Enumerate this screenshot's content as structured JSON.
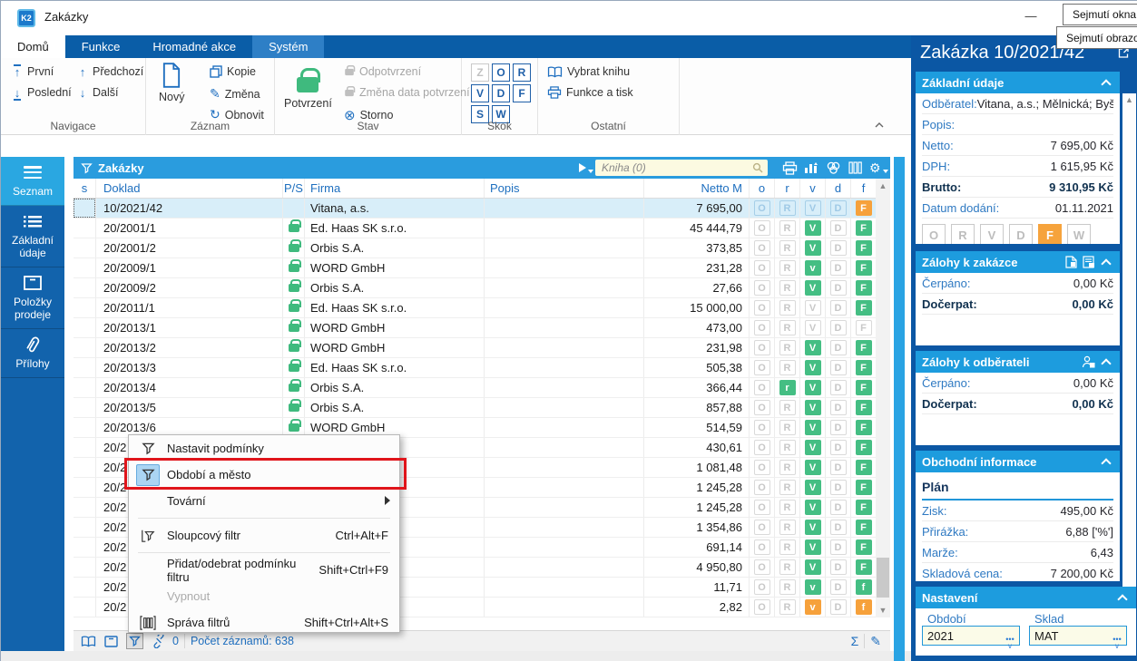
{
  "window": {
    "title": "Zakázky",
    "minimize_glyph": "—"
  },
  "capture_menu": {
    "items": [
      "Sejmutí okna",
      "Sejmutí obrazovk"
    ]
  },
  "ribbon": {
    "tabs": [
      {
        "label": "Domů"
      },
      {
        "label": "Funkce"
      },
      {
        "label": "Hromadné akce"
      },
      {
        "label": "Systém"
      }
    ],
    "groups": {
      "navigace": {
        "label": "Navigace",
        "items": [
          "První",
          "Poslední",
          "Předchozí",
          "Další"
        ]
      },
      "zaznam": {
        "label": "Záznam",
        "big": "Nový",
        "items": [
          "Kopie",
          "Změna",
          "Obnovit"
        ]
      },
      "stav": {
        "label": "Stav",
        "big": "Potvrzení",
        "items": [
          "Odpotvrzení",
          "Změna data potvrzení",
          "Storno"
        ]
      },
      "skok": {
        "label": "Skok",
        "letters": [
          "Z",
          "O",
          "R",
          "V",
          "D",
          "F",
          "S",
          "W"
        ]
      },
      "ostatni": {
        "label": "Ostatní",
        "items": [
          "Vybrat knihu",
          "Funkce a tisk"
        ]
      }
    }
  },
  "sidebar": {
    "items": [
      {
        "label": "Seznam"
      },
      {
        "label": "Základní údaje"
      },
      {
        "label": "Položky prodeje"
      },
      {
        "label": "Přílohy"
      }
    ]
  },
  "table": {
    "title": "Zakázky",
    "search_placeholder": "Kniha (0)",
    "columns": [
      "s",
      "Doklad",
      "P/S",
      "Firma",
      "Popis",
      "Netto M",
      "o",
      "r",
      "v",
      "d",
      "f"
    ],
    "rows": [
      {
        "sel": true,
        "doklad": "10/2021/42",
        "lock": "nolock",
        "firma": "Vitana, a.s.",
        "popis": "",
        "netto": "7 695,00",
        "bl": [
          "O",
          "R",
          "V",
          "D",
          "F"
        ],
        "bs": [
          "selb",
          "selb",
          "selb",
          "selb",
          "orange"
        ]
      },
      {
        "doklad": "20/2001/1",
        "lock": "lock",
        "firma": "Ed. Haas SK s.r.o.",
        "popis": "",
        "netto": "45 444,79",
        "bl": [
          "O",
          "R",
          "V",
          "D",
          "F"
        ],
        "bs": [
          "off",
          "off",
          "green",
          "off",
          "green"
        ]
      },
      {
        "doklad": "20/2001/2",
        "lock": "lock",
        "firma": "Orbis S.A.",
        "popis": "",
        "netto": "373,85",
        "bl": [
          "O",
          "R",
          "V",
          "D",
          "F"
        ],
        "bs": [
          "off",
          "off",
          "green",
          "off",
          "green"
        ]
      },
      {
        "doklad": "20/2009/1",
        "lock": "lock",
        "firma": "WORD GmbH",
        "popis": "",
        "netto": "231,28",
        "bl": [
          "O",
          "R",
          "v",
          "D",
          "F"
        ],
        "bs": [
          "off",
          "off",
          "green",
          "off",
          "green"
        ]
      },
      {
        "doklad": "20/2009/2",
        "lock": "lock",
        "firma": "Orbis S.A.",
        "popis": "",
        "netto": "27,66",
        "bl": [
          "O",
          "R",
          "V",
          "D",
          "F"
        ],
        "bs": [
          "off",
          "off",
          "green",
          "off",
          "green"
        ]
      },
      {
        "doklad": "20/2011/1",
        "lock": "lock",
        "firma": "Ed. Haas SK s.r.o.",
        "popis": "",
        "netto": "15 000,00",
        "bl": [
          "O",
          "R",
          "V",
          "D",
          "F"
        ],
        "bs": [
          "off",
          "off",
          "off",
          "off",
          "green"
        ]
      },
      {
        "doklad": "20/2013/1",
        "lock": "lock",
        "firma": "WORD GmbH",
        "popis": "",
        "netto": "473,00",
        "bl": [
          "O",
          "R",
          "V",
          "D",
          "F"
        ],
        "bs": [
          "off",
          "off",
          "off",
          "off",
          "off"
        ]
      },
      {
        "doklad": "20/2013/2",
        "lock": "lock",
        "firma": "WORD GmbH",
        "popis": "",
        "netto": "231,98",
        "bl": [
          "O",
          "R",
          "V",
          "D",
          "F"
        ],
        "bs": [
          "off",
          "off",
          "green",
          "off",
          "green"
        ]
      },
      {
        "doklad": "20/2013/3",
        "lock": "lock",
        "firma": "Ed. Haas SK s.r.o.",
        "popis": "",
        "netto": "505,38",
        "bl": [
          "O",
          "R",
          "V",
          "D",
          "F"
        ],
        "bs": [
          "off",
          "off",
          "green",
          "off",
          "green"
        ]
      },
      {
        "doklad": "20/2013/4",
        "lock": "lock",
        "firma": "Orbis S.A.",
        "popis": "",
        "netto": "366,44",
        "bl": [
          "O",
          "r",
          "V",
          "D",
          "F"
        ],
        "bs": [
          "off",
          "green",
          "green",
          "off",
          "green"
        ]
      },
      {
        "doklad": "20/2013/5",
        "lock": "lock",
        "firma": "Orbis S.A.",
        "popis": "",
        "netto": "857,88",
        "bl": [
          "O",
          "R",
          "V",
          "D",
          "F"
        ],
        "bs": [
          "off",
          "off",
          "green",
          "off",
          "green"
        ]
      },
      {
        "doklad": "20/2013/6",
        "lock": "lock",
        "firma": "WORD GmbH",
        "popis": "",
        "netto": "514,59",
        "bl": [
          "O",
          "R",
          "V",
          "D",
          "F"
        ],
        "bs": [
          "off",
          "off",
          "green",
          "off",
          "green"
        ]
      },
      {
        "doklad": "20/2",
        "lock": "nolock",
        "firma": "",
        "popis": "",
        "netto": "430,61",
        "bl": [
          "O",
          "R",
          "V",
          "D",
          "F"
        ],
        "bs": [
          "off",
          "off",
          "green",
          "off",
          "green"
        ]
      },
      {
        "doklad": "20/2",
        "lock": "nolock",
        "firma": "",
        "popis": "",
        "netto": "1 081,48",
        "bl": [
          "O",
          "R",
          "V",
          "D",
          "F"
        ],
        "bs": [
          "off",
          "off",
          "green",
          "off",
          "green"
        ]
      },
      {
        "doklad": "20/2",
        "lock": "nolock",
        "firma": "",
        "popis": "",
        "netto": "1 245,28",
        "bl": [
          "O",
          "R",
          "V",
          "D",
          "F"
        ],
        "bs": [
          "off",
          "off",
          "green",
          "off",
          "green"
        ]
      },
      {
        "doklad": "20/2",
        "lock": "nolock",
        "firma": "",
        "popis": "",
        "netto": "1 245,28",
        "bl": [
          "O",
          "R",
          "V",
          "D",
          "F"
        ],
        "bs": [
          "off",
          "off",
          "green",
          "off",
          "green"
        ]
      },
      {
        "doklad": "20/2",
        "lock": "nolock",
        "firma": "",
        "popis": "",
        "netto": "1 354,86",
        "bl": [
          "O",
          "R",
          "V",
          "D",
          "F"
        ],
        "bs": [
          "off",
          "off",
          "green",
          "off",
          "green"
        ]
      },
      {
        "doklad": "20/2",
        "lock": "nolock",
        "firma": "",
        "popis": "",
        "netto": "691,14",
        "bl": [
          "O",
          "R",
          "V",
          "D",
          "F"
        ],
        "bs": [
          "off",
          "off",
          "green",
          "off",
          "green"
        ]
      },
      {
        "doklad": "20/2",
        "lock": "nolock",
        "firma": "",
        "popis": "",
        "netto": "4 950,80",
        "bl": [
          "O",
          "R",
          "V",
          "D",
          "F"
        ],
        "bs": [
          "off",
          "off",
          "green",
          "off",
          "green"
        ]
      },
      {
        "doklad": "20/2",
        "lock": "nolock",
        "firma": "",
        "popis": "",
        "netto": "11,71",
        "bl": [
          "O",
          "R",
          "v",
          "D",
          "f"
        ],
        "bs": [
          "off",
          "off",
          "green",
          "off",
          "green"
        ]
      },
      {
        "doklad": "20/2",
        "lock": "nolock",
        "firma": "",
        "popis": "",
        "netto": "2,82",
        "bl": [
          "O",
          "R",
          "v",
          "D",
          "f"
        ],
        "bs": [
          "off",
          "off",
          "orange",
          "off",
          "orange"
        ]
      }
    ],
    "status": {
      "filter_count": "0",
      "count_label": "Počet záznamů: 638"
    }
  },
  "menu": {
    "items": [
      {
        "label": "Nastavit podmínky"
      },
      {
        "label": "Období a město"
      },
      {
        "label": "Tovární"
      },
      {
        "label": "Sloupcový filtr",
        "shortcut": "Ctrl+Alt+F"
      },
      {
        "label": "Přidat/odebrat podmínku filtru",
        "shortcut": "Shift+Ctrl+F9"
      },
      {
        "label": "Vypnout"
      },
      {
        "label": "Správa filtrů",
        "shortcut": "Shift+Ctrl+Alt+S"
      }
    ]
  },
  "panel": {
    "title": "Zakázka 10/2021/42",
    "sections": [
      {
        "title": "Základní údaje",
        "rows": [
          {
            "label": "Odběratel:",
            "value": "Vitana, a.s.; Mělnická; Byši..."
          },
          {
            "label": "Popis:",
            "value": ""
          },
          {
            "label": "Netto:",
            "value": "7 695,00 Kč"
          },
          {
            "label": "DPH:",
            "value": "1 615,95 Kč"
          },
          {
            "label": "Brutto:",
            "value": "9 310,95 Kč"
          },
          {
            "label": "Datum dodání:",
            "value": "01.11.2021"
          }
        ],
        "letters": [
          "O",
          "R",
          "V",
          "D",
          "F",
          "W"
        ]
      },
      {
        "title": "Zálohy k zakázce",
        "rows": [
          {
            "label": "Čerpáno:",
            "value": "0,00 Kč"
          },
          {
            "label": "Dočerpat:",
            "value": "0,00 Kč"
          }
        ]
      },
      {
        "title": "Zálohy k odběrateli",
        "rows": [
          {
            "label": "Čerpáno:",
            "value": "0,00 Kč"
          },
          {
            "label": "Dočerpat:",
            "value": "0,00 Kč"
          }
        ]
      },
      {
        "title": "Obchodní informace",
        "subtitle": "Plán",
        "rows": [
          {
            "label": "Zisk:",
            "value": "495,00 Kč"
          },
          {
            "label": "Přirážka:",
            "value": "6,88 ['%']"
          },
          {
            "label": "Marže:",
            "value": "6,43"
          },
          {
            "label": "Skladová cena:",
            "value": "7 200,00 Kč"
          }
        ]
      },
      {
        "title": "Nastavení",
        "fields": [
          {
            "label": "Období",
            "value": "2021"
          },
          {
            "label": "Sklad",
            "value": "MAT"
          }
        ]
      }
    ]
  },
  "icons": {
    "refresh-icon": "↻",
    "pencil-icon": "✎",
    "storno-icon": "⊗",
    "sum-icon": "Σ",
    "gear-icon": "⚙",
    "scroll-up": "▲",
    "scroll-down": "▼"
  },
  "colors": {
    "ribbon_blue": "#0A5DA7",
    "accent_blue": "#1D9CDE",
    "sidebar_blue": "#1263AC",
    "active_blue": "#2AA7E1",
    "green_badge": "#44BE83",
    "orange_badge": "#F6A13B",
    "selection_row": "#D8EEF9",
    "annotation_red": "#E0151B",
    "panel_bg": "#0B57A4"
  }
}
